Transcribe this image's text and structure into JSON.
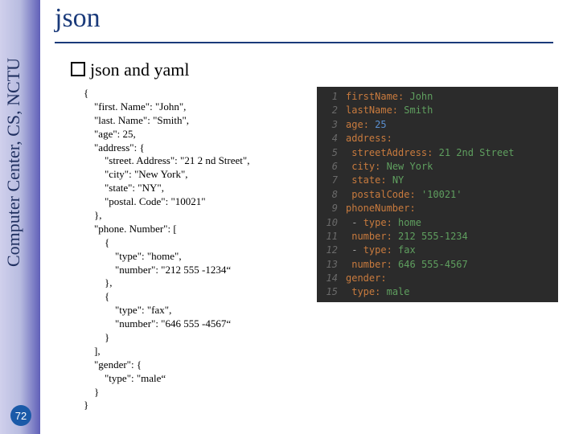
{
  "sidebar": {
    "label": "Computer Center, CS, NCTU"
  },
  "page": {
    "number": "72"
  },
  "title": "json",
  "bullet": "json and yaml",
  "json_lines": [
    "{",
    "    \"first. Name\": \"John\",",
    "    \"last. Name\": \"Smith\",",
    "    \"age\": 25,",
    "    \"address\": {",
    "        \"street. Address\": \"21 2 nd Street\",",
    "        \"city\": \"New York\",",
    "        \"state\": \"NY\",",
    "        \"postal. Code\": \"10021\"",
    "    },",
    "    \"phone. Number\": [",
    "        {",
    "            \"type\": \"home\",",
    "            \"number\": \"212 555 -1234“",
    "        },",
    "        {",
    "            \"type\": \"fax\",",
    "            \"number\": \"646 555 -4567“",
    "        }",
    "    ],",
    "    \"gender\": {",
    "        \"type\": \"male“",
    "    }",
    "}"
  ],
  "yaml_lines": [
    {
      "n": "1",
      "key": "firstName",
      "sep": ": ",
      "val": "John",
      "vclass": "val"
    },
    {
      "n": "2",
      "key": "lastName",
      "sep": ": ",
      "val": "Smith",
      "vclass": "val"
    },
    {
      "n": "3",
      "key": "age",
      "sep": ": ",
      "val": "25",
      "vclass": "num"
    },
    {
      "n": "4",
      "key": "address",
      "sep": ":",
      "val": "",
      "vclass": ""
    },
    {
      "n": "5",
      "indent": "    ",
      "key": "streetAddress",
      "sep": ": ",
      "val": "21 2nd Street",
      "vclass": "val"
    },
    {
      "n": "6",
      "indent": "    ",
      "key": "city",
      "sep": ": ",
      "val": "New York",
      "vclass": "val"
    },
    {
      "n": "7",
      "indent": "    ",
      "key": "state",
      "sep": ": ",
      "val": "NY",
      "vclass": "val"
    },
    {
      "n": "8",
      "indent": "    ",
      "key": "postalCode",
      "sep": ": ",
      "val": "'10021'",
      "vclass": "str"
    },
    {
      "n": "9",
      "key": "phoneNumber",
      "sep": ":",
      "val": "",
      "vclass": ""
    },
    {
      "n": "10",
      "indent": "    ",
      "dash": "- ",
      "key": "type",
      "sep": ": ",
      "val": "home",
      "vclass": "val"
    },
    {
      "n": "11",
      "indent": "      ",
      "key": "number",
      "sep": ": ",
      "val": "212 555-1234",
      "vclass": "val"
    },
    {
      "n": "12",
      "indent": "    ",
      "dash": "- ",
      "key": "type",
      "sep": ": ",
      "val": "fax",
      "vclass": "val"
    },
    {
      "n": "13",
      "indent": "      ",
      "key": "number",
      "sep": ": ",
      "val": "646 555-4567",
      "vclass": "val"
    },
    {
      "n": "14",
      "key": "gender",
      "sep": ":",
      "val": "",
      "vclass": ""
    },
    {
      "n": "15",
      "indent": "    ",
      "key": "type",
      "sep": ": ",
      "val": "male",
      "vclass": "val"
    }
  ]
}
